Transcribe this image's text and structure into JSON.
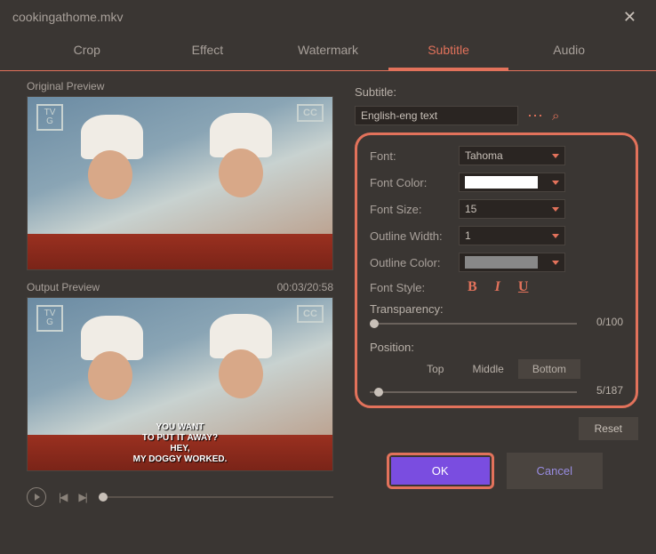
{
  "titlebar": {
    "filename": "cookingathome.mkv"
  },
  "tabs": {
    "items": [
      "Crop",
      "Effect",
      "Watermark",
      "Subtitle",
      "Audio"
    ],
    "active": "Subtitle"
  },
  "previews": {
    "original_label": "Original Preview",
    "output_label": "Output Preview",
    "timecode": "00:03/20:58",
    "tvg": "TV\nG",
    "cc": "CC",
    "subtitle_lines": "YOU WANT\nTO PUT IT AWAY?\nHEY,\nMY DOGGY WORKED."
  },
  "panel": {
    "subtitle_label": "Subtitle:",
    "subtitle_value": "English-eng text",
    "font_label": "Font:",
    "font_value": "Tahoma",
    "font_color_label": "Font Color:",
    "font_color": "#ffffff",
    "font_size_label": "Font Size:",
    "font_size_value": "15",
    "outline_width_label": "Outline Width:",
    "outline_width_value": "1",
    "outline_color_label": "Outline Color:",
    "outline_color": "#888888",
    "font_style_label": "Font Style:",
    "transparency_label": "Transparency:",
    "transparency_value": "0/100",
    "position_label": "Position:",
    "position_options": {
      "top": "Top",
      "middle": "Middle",
      "bottom": "Bottom"
    },
    "position_active": "Bottom",
    "position_value": "5/187",
    "reset_label": "Reset"
  },
  "footer": {
    "ok": "OK",
    "cancel": "Cancel"
  }
}
